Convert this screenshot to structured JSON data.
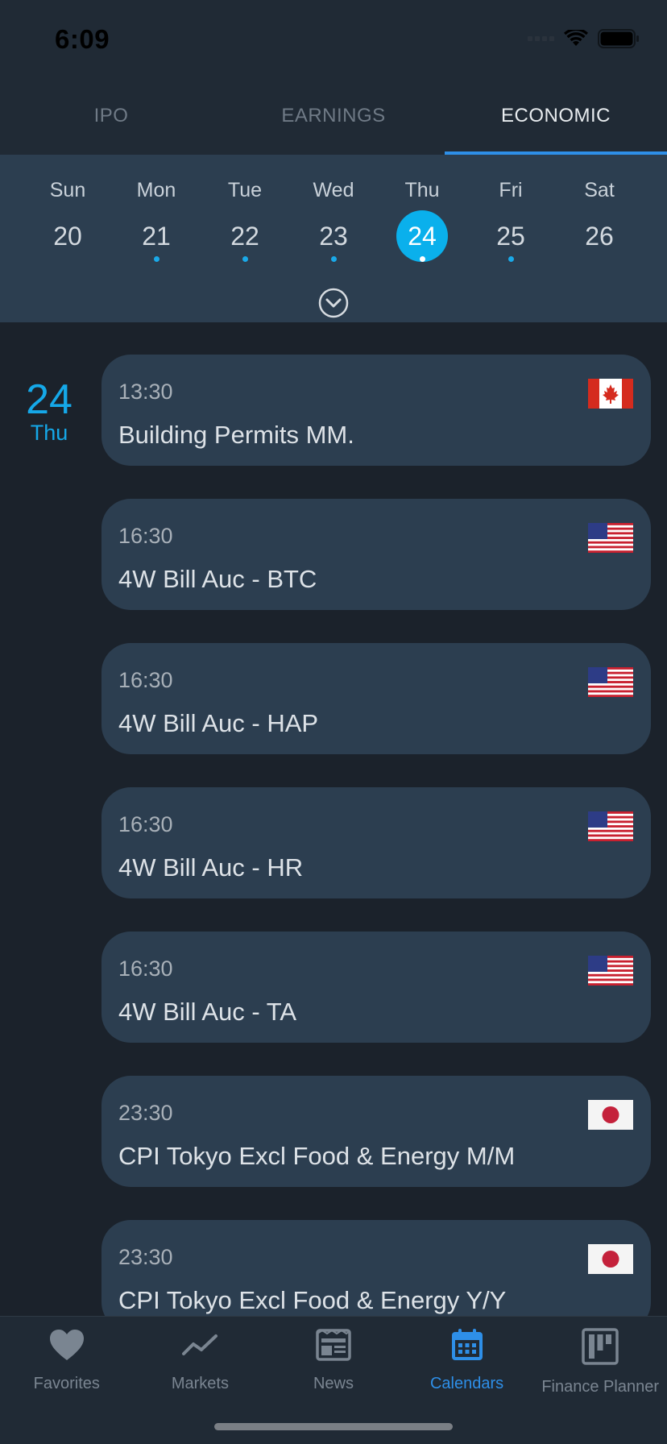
{
  "status": {
    "time": "6:09"
  },
  "tabs": [
    {
      "label": "IPO",
      "active": false
    },
    {
      "label": "EARNINGS",
      "active": false
    },
    {
      "label": "ECONOMIC",
      "active": true
    }
  ],
  "week": {
    "days": [
      {
        "dow": "Sun",
        "date": "20",
        "has_events": false,
        "selected": false
      },
      {
        "dow": "Mon",
        "date": "21",
        "has_events": true,
        "selected": false
      },
      {
        "dow": "Tue",
        "date": "22",
        "has_events": true,
        "selected": false
      },
      {
        "dow": "Wed",
        "date": "23",
        "has_events": true,
        "selected": false
      },
      {
        "dow": "Thu",
        "date": "24",
        "has_events": true,
        "selected": true
      },
      {
        "dow": "Fri",
        "date": "25",
        "has_events": true,
        "selected": false
      },
      {
        "dow": "Sat",
        "date": "26",
        "has_events": false,
        "selected": false
      }
    ],
    "expand_icon": "chevron-circle-down-icon"
  },
  "day_header": {
    "day": "24",
    "name": "Thu"
  },
  "events": [
    {
      "time": "13:30",
      "title": "Building Permits MM.",
      "flag": "canada-flag-icon"
    },
    {
      "time": "16:30",
      "title": "4W Bill Auc - BTC",
      "flag": "us-flag-icon"
    },
    {
      "time": "16:30",
      "title": "4W Bill Auc - HAP",
      "flag": "us-flag-icon"
    },
    {
      "time": "16:30",
      "title": "4W Bill Auc - HR",
      "flag": "us-flag-icon"
    },
    {
      "time": "16:30",
      "title": "4W Bill Auc - TA",
      "flag": "us-flag-icon"
    },
    {
      "time": "23:30",
      "title": "CPI Tokyo  Excl Food & Energy M/M",
      "flag": "japan-flag-icon"
    },
    {
      "time": "23:30",
      "title": "CPI Tokyo  Excl Food & Energy Y/Y",
      "flag": "japan-flag-icon"
    }
  ],
  "tabbar": [
    {
      "label": "Favorites",
      "icon": "heart-icon",
      "active": false
    },
    {
      "label": "Markets",
      "icon": "trend-line-icon",
      "active": false
    },
    {
      "label": "News",
      "icon": "newspaper-icon",
      "active": false
    },
    {
      "label": "Calendars",
      "icon": "calendar-icon",
      "active": true
    },
    {
      "label": "Finance Planner",
      "icon": "kanban-board-icon",
      "active": false
    }
  ],
  "colors": {
    "accent": "#2e8fe8",
    "selected_date": "#0ab0ec",
    "card": "#2c3e50",
    "background": "#1b222b"
  }
}
